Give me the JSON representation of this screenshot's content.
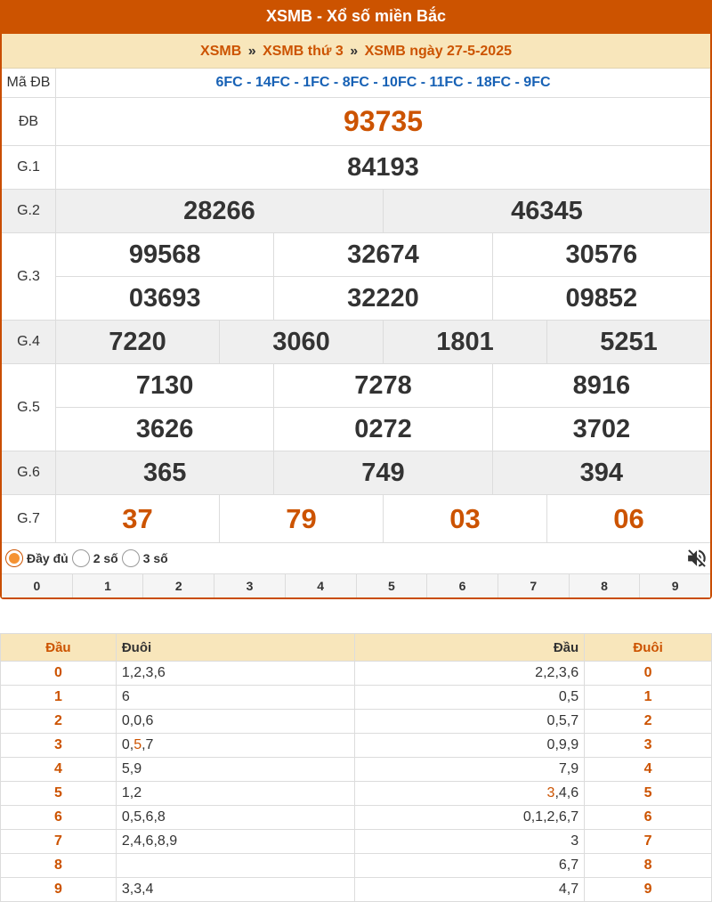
{
  "title": "XSMB - Xổ số miền Bắc",
  "breadcrumb": {
    "home": "XSMB",
    "day": "XSMB thứ 3",
    "date": "XSMB ngày 27-5-2025",
    "separator": "»"
  },
  "madb": {
    "label": "Mã ĐB",
    "value": "6FC - 14FC - 1FC - 8FC - 10FC - 11FC - 18FC - 9FC"
  },
  "prizes": {
    "db": {
      "label": "ĐB",
      "numbers": [
        "93735"
      ]
    },
    "g1": {
      "label": "G.1",
      "numbers": [
        "84193"
      ]
    },
    "g2": {
      "label": "G.2",
      "numbers": [
        "28266",
        "46345"
      ]
    },
    "g3": {
      "label": "G.3",
      "numbers": [
        "99568",
        "32674",
        "30576",
        "03693",
        "32220",
        "09852"
      ]
    },
    "g4": {
      "label": "G.4",
      "numbers": [
        "7220",
        "3060",
        "1801",
        "5251"
      ]
    },
    "g5": {
      "label": "G.5",
      "numbers": [
        "7130",
        "7278",
        "8916",
        "3626",
        "0272",
        "3702"
      ]
    },
    "g6": {
      "label": "G.6",
      "numbers": [
        "365",
        "749",
        "394"
      ]
    },
    "g7": {
      "label": "G.7",
      "numbers": [
        "37",
        "79",
        "03",
        "06"
      ]
    }
  },
  "options": {
    "full": "Đầy đủ",
    "two": "2 số",
    "three": "3 số",
    "selected": "full",
    "mute_icon": "volume-mute-icon"
  },
  "digits": [
    "0",
    "1",
    "2",
    "3",
    "4",
    "5",
    "6",
    "7",
    "8",
    "9"
  ],
  "loto": {
    "headers": [
      "Đầu",
      "Đuôi",
      "Đầu",
      "Đuôi"
    ],
    "rows": [
      {
        "dau": "0",
        "duoi": [
          "1",
          "2",
          "3",
          "6"
        ],
        "dau_r": [
          "2",
          "2",
          "3",
          "6"
        ],
        "duoi_r": "0"
      },
      {
        "dau": "1",
        "duoi": [
          "6"
        ],
        "dau_r": [
          "0",
          "5"
        ],
        "duoi_r": "1"
      },
      {
        "dau": "2",
        "duoi": [
          "0",
          "0",
          "6"
        ],
        "dau_r": [
          "0",
          "5",
          "7"
        ],
        "duoi_r": "2"
      },
      {
        "dau": "3",
        "duoi": [
          "0",
          "5",
          "7"
        ],
        "duoi_hl": [
          1
        ],
        "dau_r": [
          "0",
          "9",
          "9"
        ],
        "duoi_r": "3"
      },
      {
        "dau": "4",
        "duoi": [
          "5",
          "9"
        ],
        "dau_r": [
          "7",
          "9"
        ],
        "duoi_r": "4"
      },
      {
        "dau": "5",
        "duoi": [
          "1",
          "2"
        ],
        "dau_r": [
          "3",
          "4",
          "6"
        ],
        "dau_r_hl": [
          0
        ],
        "duoi_r": "5"
      },
      {
        "dau": "6",
        "duoi": [
          "0",
          "5",
          "6",
          "8"
        ],
        "dau_r": [
          "0",
          "1",
          "2",
          "6",
          "7"
        ],
        "duoi_r": "6"
      },
      {
        "dau": "7",
        "duoi": [
          "2",
          "4",
          "6",
          "8",
          "9"
        ],
        "dau_r": [
          "3"
        ],
        "duoi_r": "7"
      },
      {
        "dau": "8",
        "duoi": [],
        "dau_r": [
          "6",
          "7"
        ],
        "duoi_r": "8"
      },
      {
        "dau": "9",
        "duoi": [
          "3",
          "3",
          "4"
        ],
        "dau_r": [
          "4",
          "7"
        ],
        "duoi_r": "9"
      }
    ]
  },
  "colors": {
    "accent": "#cc5300",
    "header_bg": "#f8e6bb",
    "link_blue": "#1761b5"
  }
}
